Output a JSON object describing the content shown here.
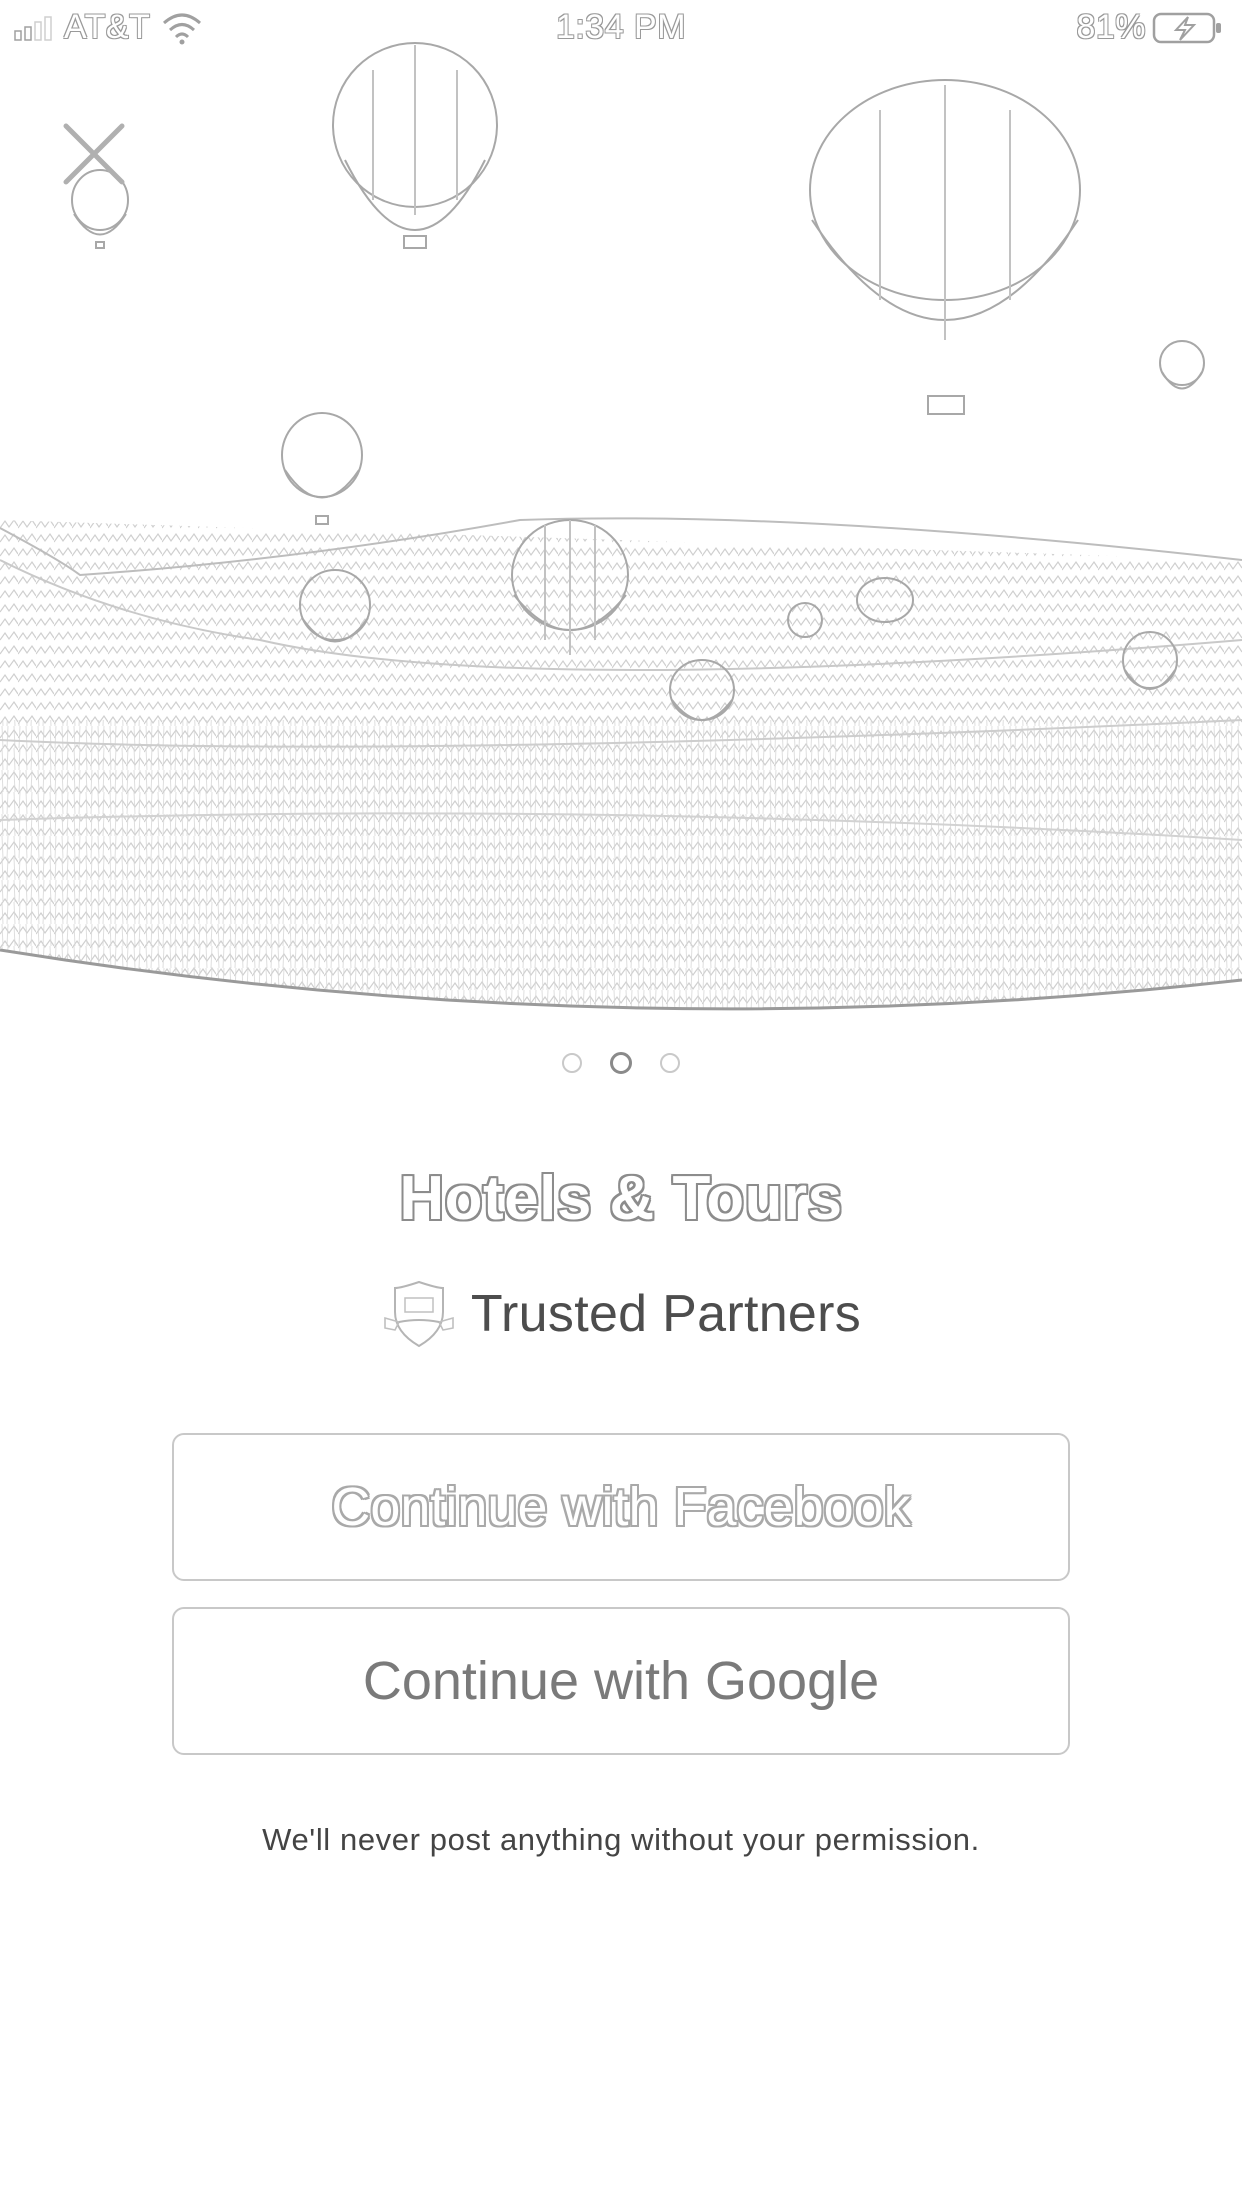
{
  "status_bar": {
    "carrier": "AT&T",
    "time": "1:34 PM",
    "battery": "81%"
  },
  "hero": {
    "image": "hot-air-balloons-landscape-sketch",
    "close_icon": "close-icon"
  },
  "pager": {
    "count": 3,
    "active_index": 1
  },
  "content": {
    "title": "Hotels & Tours",
    "trusted_label": "Trusted Partners",
    "trusted_icon": "shield-badge-icon"
  },
  "buttons": {
    "facebook": "Continue with Facebook",
    "google": "Continue with Google"
  },
  "disclaimer": "We'll never post anything without your permission."
}
